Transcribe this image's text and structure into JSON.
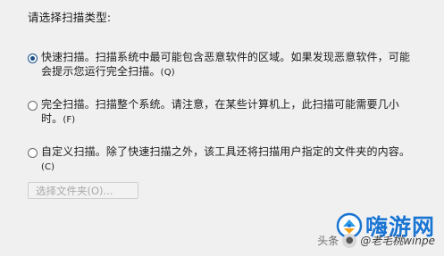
{
  "heading": "请选择扫描类型:",
  "options": [
    {
      "text": "快速扫描。扫描系统中最可能包含恶意软件的区域。如果发现恶意软件，可能会提示您运行完全扫描。",
      "accel": "(Q)",
      "selected": true
    },
    {
      "text": "完全扫描。扫描整个系统。请注意，在某些计算机上，此扫描可能需要几小时。",
      "accel": "(F)",
      "selected": false
    },
    {
      "text": "自定义扫描。除了快速扫描之外，该工具还将扫描用户指定的文件夹的内容。",
      "accel": "(C)",
      "selected": false
    }
  ],
  "select_folder_label": "选择文件夹(O)...",
  "watermark": {
    "source": "头条",
    "author": "@老毛桃winpe"
  },
  "logo": {
    "text": "嗨游网",
    "color": "#1a74d2"
  }
}
